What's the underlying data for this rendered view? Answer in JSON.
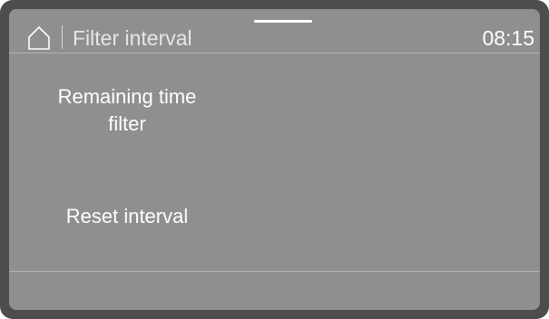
{
  "header": {
    "home_icon": "home-icon",
    "title": "Filter interval",
    "clock": "08:15"
  },
  "menu": {
    "items": [
      {
        "label_line1": "Remaining time",
        "label_line2": "filter"
      },
      {
        "label_line1": "Reset interval"
      }
    ]
  },
  "colors": {
    "bezel": "#4d4d4d",
    "screen": "#8e8f91",
    "text": "#ffffff",
    "divider": "#b3b3b3"
  }
}
